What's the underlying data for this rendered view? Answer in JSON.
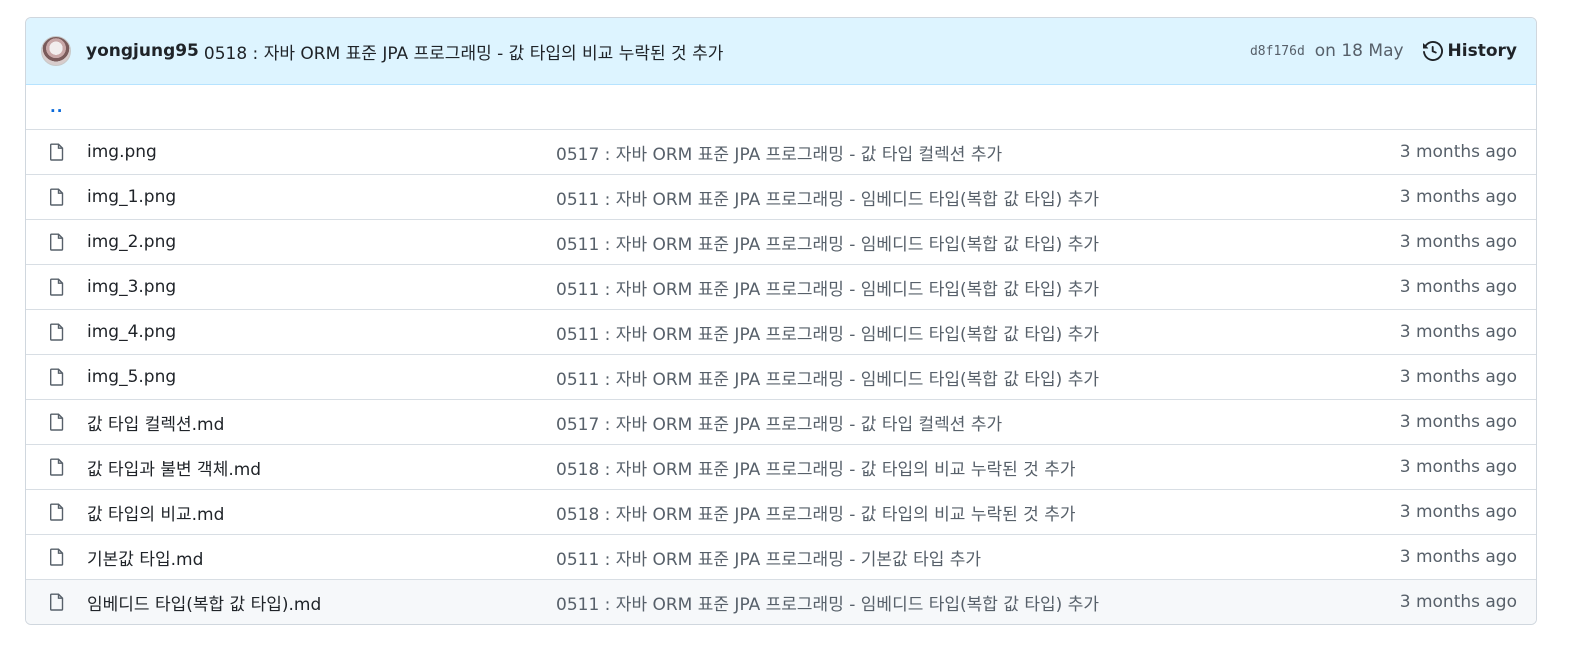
{
  "commit": {
    "author": "yongjung95",
    "message": "0518 : 자바 ORM 표준 JPA 프로그래밍 - 값 타입의 비교 누락된 것 추가",
    "sha": "d8f176d",
    "date": "on 18 May",
    "history_label": "History"
  },
  "parent_dir": "..",
  "files": [
    {
      "name": "img.png",
      "message": "0517 : 자바 ORM 표준 JPA 프로그래밍 - 값 타입 컬렉션 추가",
      "age": "3 months ago"
    },
    {
      "name": "img_1.png",
      "message": "0511 : 자바 ORM 표준 JPA 프로그래밍 - 임베디드 타입(복합 값 타입) 추가",
      "age": "3 months ago"
    },
    {
      "name": "img_2.png",
      "message": "0511 : 자바 ORM 표준 JPA 프로그래밍 - 임베디드 타입(복합 값 타입) 추가",
      "age": "3 months ago"
    },
    {
      "name": "img_3.png",
      "message": "0511 : 자바 ORM 표준 JPA 프로그래밍 - 임베디드 타입(복합 값 타입) 추가",
      "age": "3 months ago"
    },
    {
      "name": "img_4.png",
      "message": "0511 : 자바 ORM 표준 JPA 프로그래밍 - 임베디드 타입(복합 값 타입) 추가",
      "age": "3 months ago"
    },
    {
      "name": "img_5.png",
      "message": "0511 : 자바 ORM 표준 JPA 프로그래밍 - 임베디드 타입(복합 값 타입) 추가",
      "age": "3 months ago"
    },
    {
      "name": "값 타입 컬렉션.md",
      "message": "0517 : 자바 ORM 표준 JPA 프로그래밍 - 값 타입 컬렉션 추가",
      "age": "3 months ago"
    },
    {
      "name": "값 타입과 불변 객체.md",
      "message": "0518 : 자바 ORM 표준 JPA 프로그래밍 - 값 타입의 비교 누락된 것 추가",
      "age": "3 months ago"
    },
    {
      "name": "값 타입의 비교.md",
      "message": "0518 : 자바 ORM 표준 JPA 프로그래밍 - 값 타입의 비교 누락된 것 추가",
      "age": "3 months ago"
    },
    {
      "name": "기본값 타입.md",
      "message": "0511 : 자바 ORM 표준 JPA 프로그래밍 - 기본값 타입 추가",
      "age": "3 months ago"
    },
    {
      "name": "임베디드 타입(복합 값 타입).md",
      "message": "0511 : 자바 ORM 표준 JPA 프로그래밍 - 임베디드 타입(복합 값 타입) 추가",
      "age": "3 months ago"
    }
  ],
  "icons": {
    "avatar": "avatar",
    "history": "history-icon",
    "file": "file-icon"
  },
  "colors": {
    "header_bg": "#ddf4ff",
    "link": "#0969da",
    "muted": "#57606a"
  }
}
